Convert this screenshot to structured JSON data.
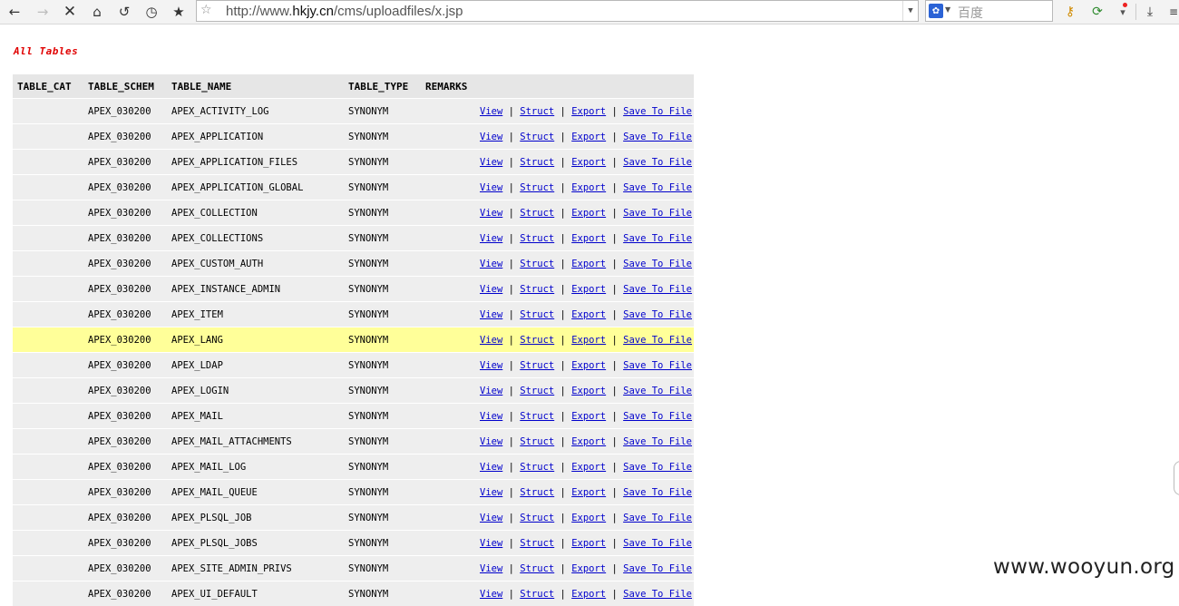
{
  "browser": {
    "url_prefix": "http://www.",
    "url_host": "hkjy.cn",
    "url_path": "/cms/uploadfiles/x.jsp",
    "search_placeholder": "百度",
    "search_engine_glyph": "✿"
  },
  "page": {
    "heading": "All Tables",
    "columns": [
      "TABLE_CAT",
      "TABLE_SCHEM",
      "TABLE_NAME",
      "TABLE_TYPE",
      "REMARKS"
    ],
    "actions": {
      "view": "View",
      "struct": "Struct",
      "export": "Export",
      "save": "Save To File",
      "sep": "|"
    },
    "rows": [
      {
        "cat": "",
        "schem": "APEX_030200",
        "name": "APEX_ACTIVITY_LOG",
        "type": "SYNONYM",
        "remarks": ""
      },
      {
        "cat": "",
        "schem": "APEX_030200",
        "name": "APEX_APPLICATION",
        "type": "SYNONYM",
        "remarks": ""
      },
      {
        "cat": "",
        "schem": "APEX_030200",
        "name": "APEX_APPLICATION_FILES",
        "type": "SYNONYM",
        "remarks": ""
      },
      {
        "cat": "",
        "schem": "APEX_030200",
        "name": "APEX_APPLICATION_GLOBAL",
        "type": "SYNONYM",
        "remarks": ""
      },
      {
        "cat": "",
        "schem": "APEX_030200",
        "name": "APEX_COLLECTION",
        "type": "SYNONYM",
        "remarks": ""
      },
      {
        "cat": "",
        "schem": "APEX_030200",
        "name": "APEX_COLLECTIONS",
        "type": "SYNONYM",
        "remarks": ""
      },
      {
        "cat": "",
        "schem": "APEX_030200",
        "name": "APEX_CUSTOM_AUTH",
        "type": "SYNONYM",
        "remarks": ""
      },
      {
        "cat": "",
        "schem": "APEX_030200",
        "name": "APEX_INSTANCE_ADMIN",
        "type": "SYNONYM",
        "remarks": ""
      },
      {
        "cat": "",
        "schem": "APEX_030200",
        "name": "APEX_ITEM",
        "type": "SYNONYM",
        "remarks": ""
      },
      {
        "cat": "",
        "schem": "APEX_030200",
        "name": "APEX_LANG",
        "type": "SYNONYM",
        "remarks": "",
        "highlighted": true
      },
      {
        "cat": "",
        "schem": "APEX_030200",
        "name": "APEX_LDAP",
        "type": "SYNONYM",
        "remarks": ""
      },
      {
        "cat": "",
        "schem": "APEX_030200",
        "name": "APEX_LOGIN",
        "type": "SYNONYM",
        "remarks": ""
      },
      {
        "cat": "",
        "schem": "APEX_030200",
        "name": "APEX_MAIL",
        "type": "SYNONYM",
        "remarks": ""
      },
      {
        "cat": "",
        "schem": "APEX_030200",
        "name": "APEX_MAIL_ATTACHMENTS",
        "type": "SYNONYM",
        "remarks": ""
      },
      {
        "cat": "",
        "schem": "APEX_030200",
        "name": "APEX_MAIL_LOG",
        "type": "SYNONYM",
        "remarks": ""
      },
      {
        "cat": "",
        "schem": "APEX_030200",
        "name": "APEX_MAIL_QUEUE",
        "type": "SYNONYM",
        "remarks": ""
      },
      {
        "cat": "",
        "schem": "APEX_030200",
        "name": "APEX_PLSQL_JOB",
        "type": "SYNONYM",
        "remarks": ""
      },
      {
        "cat": "",
        "schem": "APEX_030200",
        "name": "APEX_PLSQL_JOBS",
        "type": "SYNONYM",
        "remarks": ""
      },
      {
        "cat": "",
        "schem": "APEX_030200",
        "name": "APEX_SITE_ADMIN_PRIVS",
        "type": "SYNONYM",
        "remarks": ""
      },
      {
        "cat": "",
        "schem": "APEX_030200",
        "name": "APEX_UI_DEFAULT",
        "type": "SYNONYM",
        "remarks": ""
      }
    ]
  },
  "watermark": "www.wooyun.org"
}
